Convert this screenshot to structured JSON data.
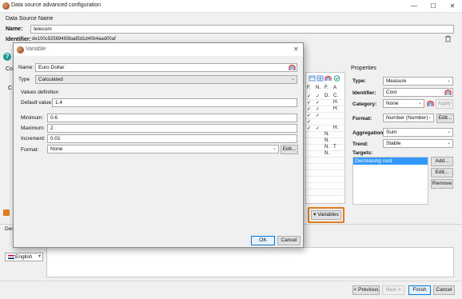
{
  "window": {
    "title": "Data source advanced configuration",
    "minimize": "—",
    "maximize": "☐",
    "close": "✕"
  },
  "datasource": {
    "section_label": "Data Source Name",
    "name_label": "Name:",
    "name_value": "telecom",
    "identifier_label": "Identifier:",
    "identifier_value": "de100c92569483bad5d1d40b4aad00af"
  },
  "left_fragments": {
    "co": "Co",
    "c": "C"
  },
  "grid": {
    "headers": [
      "F.",
      "N.",
      "F.",
      "A"
    ],
    "rows": [
      [
        "✓",
        "✓",
        "D.",
        "C."
      ],
      [
        "✓",
        "✓",
        "",
        "H."
      ],
      [
        "✓",
        "✓",
        "",
        "H."
      ],
      [
        "✓",
        "✓",
        "",
        ""
      ],
      [
        "✓",
        "",
        "",
        ""
      ],
      [
        "✓",
        "✓",
        "",
        "H."
      ],
      [
        "",
        "",
        "N.",
        ""
      ],
      [
        "",
        "",
        "N.",
        ""
      ],
      [
        "",
        "",
        "N.",
        "T"
      ],
      [
        "",
        "",
        "N.",
        ""
      ]
    ]
  },
  "variables_button": "▾ Variables",
  "properties": {
    "title": "Properties",
    "type_label": "Type:",
    "type_value": "Measure",
    "identifier_label": "Identifier:",
    "identifier_value": "Cost",
    "category_label": "Category:",
    "category_value": "None",
    "apply_label": "Apply",
    "format_label": "Format:",
    "format_value": "Number (Number)",
    "format_edit": "Edit...",
    "aggregation_label": "Aggregation:",
    "aggregation_value": "Sum",
    "trend_label": "Trend:",
    "trend_value": "Stable",
    "targets_label": "Targets:",
    "targets": [
      "Decreasing cost"
    ],
    "add_label": "Add...",
    "edit_label": "Edit...",
    "remove_label": "Remove"
  },
  "description": {
    "label": "Des",
    "language": "English"
  },
  "footer": {
    "previous": "< Previous",
    "next": "Next >",
    "finish": "Finish",
    "cancel": "Cancel"
  },
  "dialog": {
    "title": "Variable",
    "name_label": "Name:",
    "name_value": "Euro Dollar",
    "type_label": "Type",
    "type_value": "Calculated",
    "values_section": "Values definition",
    "default_label": "Default value:",
    "default_value": "1.4",
    "minimum_label": "Minimum:",
    "minimum_value": "0.6",
    "maximum_label": "Maximum:",
    "maximum_value": "2",
    "increment_label": "Increment:",
    "increment_value": "0.01",
    "format_label": "Format:",
    "format_value": "None",
    "format_edit": "Edit...",
    "ok": "OK",
    "cancel": "Cancel"
  },
  "colors": {
    "accent": "#0078d7",
    "highlight": "#e07b1f",
    "selection": "#3399ff"
  }
}
